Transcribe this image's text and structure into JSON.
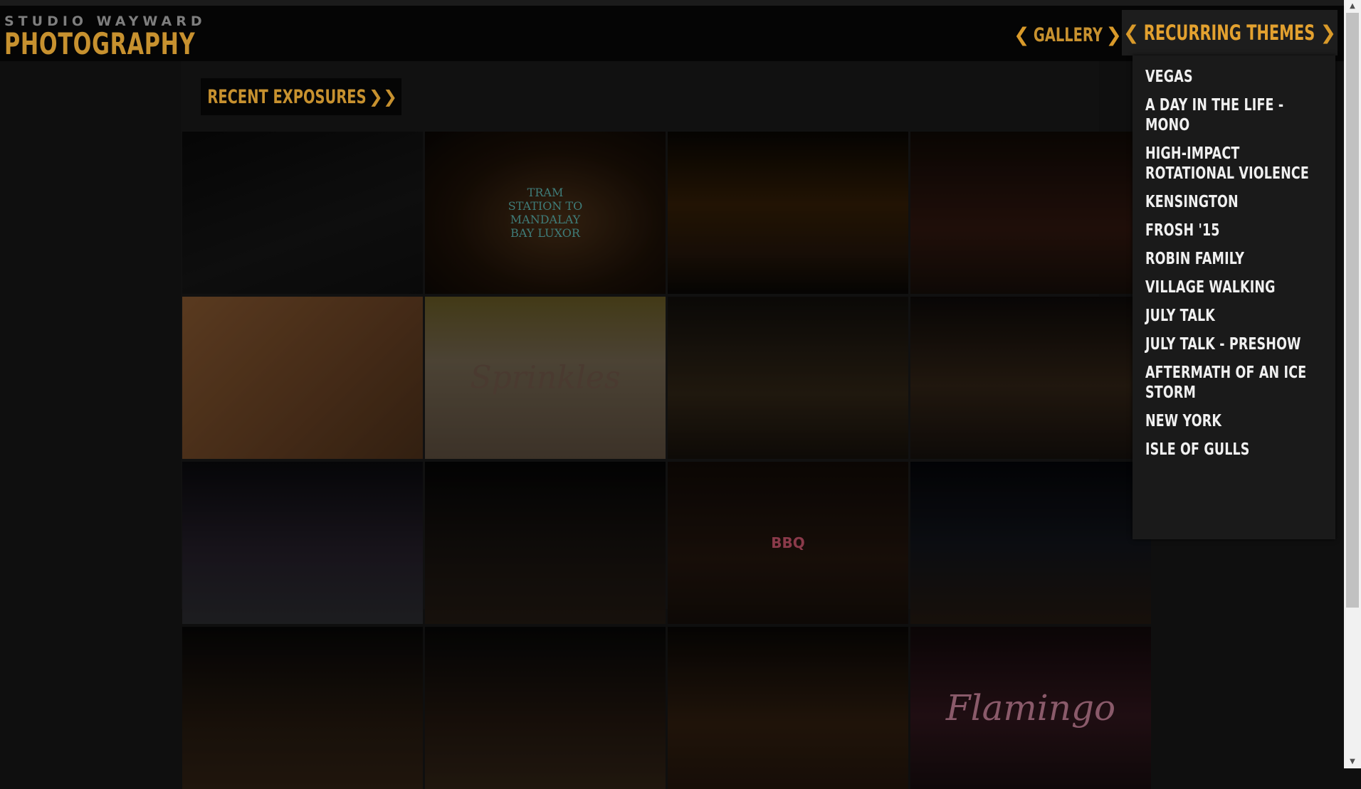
{
  "brand": {
    "top": "STUDIO WAYWARD",
    "main": "PHOTOGRAPHY"
  },
  "nav": {
    "gallery_label": "GALLERY",
    "themes_label": "RECURRING THEMES",
    "chev_left": "❮",
    "chev_right": "❯"
  },
  "dropdown": {
    "items": [
      "VEGAS",
      "A DAY IN THE LIFE - MONO",
      "HIGH-IMPACT ROTATIONAL VIOLENCE",
      "KENSINGTON",
      "FROSH '15",
      "ROBIN FAMILY",
      "VILLAGE WALKING",
      "JULY TALK",
      "JULY TALK - PRESHOW",
      "AFTERMATH OF AN ICE STORM",
      "NEW YORK",
      "ISLE OF GULLS"
    ]
  },
  "recent": {
    "label": "RECENT EXPOSURES",
    "suffix": "❯❯"
  },
  "tiles": [
    {
      "text": ""
    },
    {
      "text": "TRAM STATION TO MANDALAY BAY LUXOR"
    },
    {
      "text": ""
    },
    {
      "text": ""
    },
    {
      "text": ""
    },
    {
      "text": "Sprinkles"
    },
    {
      "text": ""
    },
    {
      "text": ""
    },
    {
      "text": ""
    },
    {
      "text": ""
    },
    {
      "text": "BBQ"
    },
    {
      "text": ""
    },
    {
      "text": ""
    },
    {
      "text": ""
    },
    {
      "text": ""
    },
    {
      "text": "Flamingo"
    }
  ],
  "colors": {
    "accent": "#c7912f",
    "accent_bright": "#e3a12f",
    "menu_text": "#f0f0f0"
  }
}
